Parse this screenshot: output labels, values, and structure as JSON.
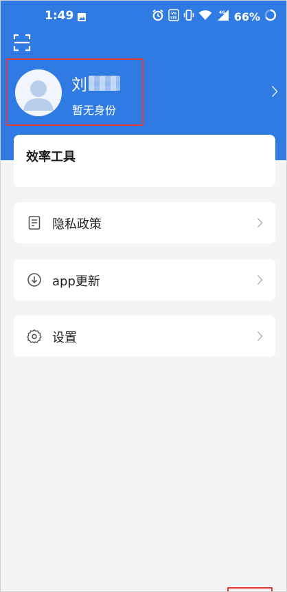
{
  "status_bar": {
    "time": "1:49",
    "battery": "66%",
    "icons": [
      "image-icon",
      "alarm-icon",
      "volte-icon",
      "vibrate-icon",
      "wifi-icon",
      "signal-4g-icon",
      "battery-ring-icon"
    ]
  },
  "header": {
    "scan_icon": "scan-icon",
    "accent_color": "#2f7be3"
  },
  "profile": {
    "name": "刘",
    "role": "暂无身份",
    "avatar_icon": "default-avatar-icon"
  },
  "tools": {
    "title": "效率工具"
  },
  "menu": {
    "items": [
      {
        "label": "隐私政策",
        "icon": "document-icon"
      },
      {
        "label": "app更新",
        "icon": "download-circle-icon"
      },
      {
        "label": "设置",
        "icon": "gear-icon"
      }
    ]
  }
}
